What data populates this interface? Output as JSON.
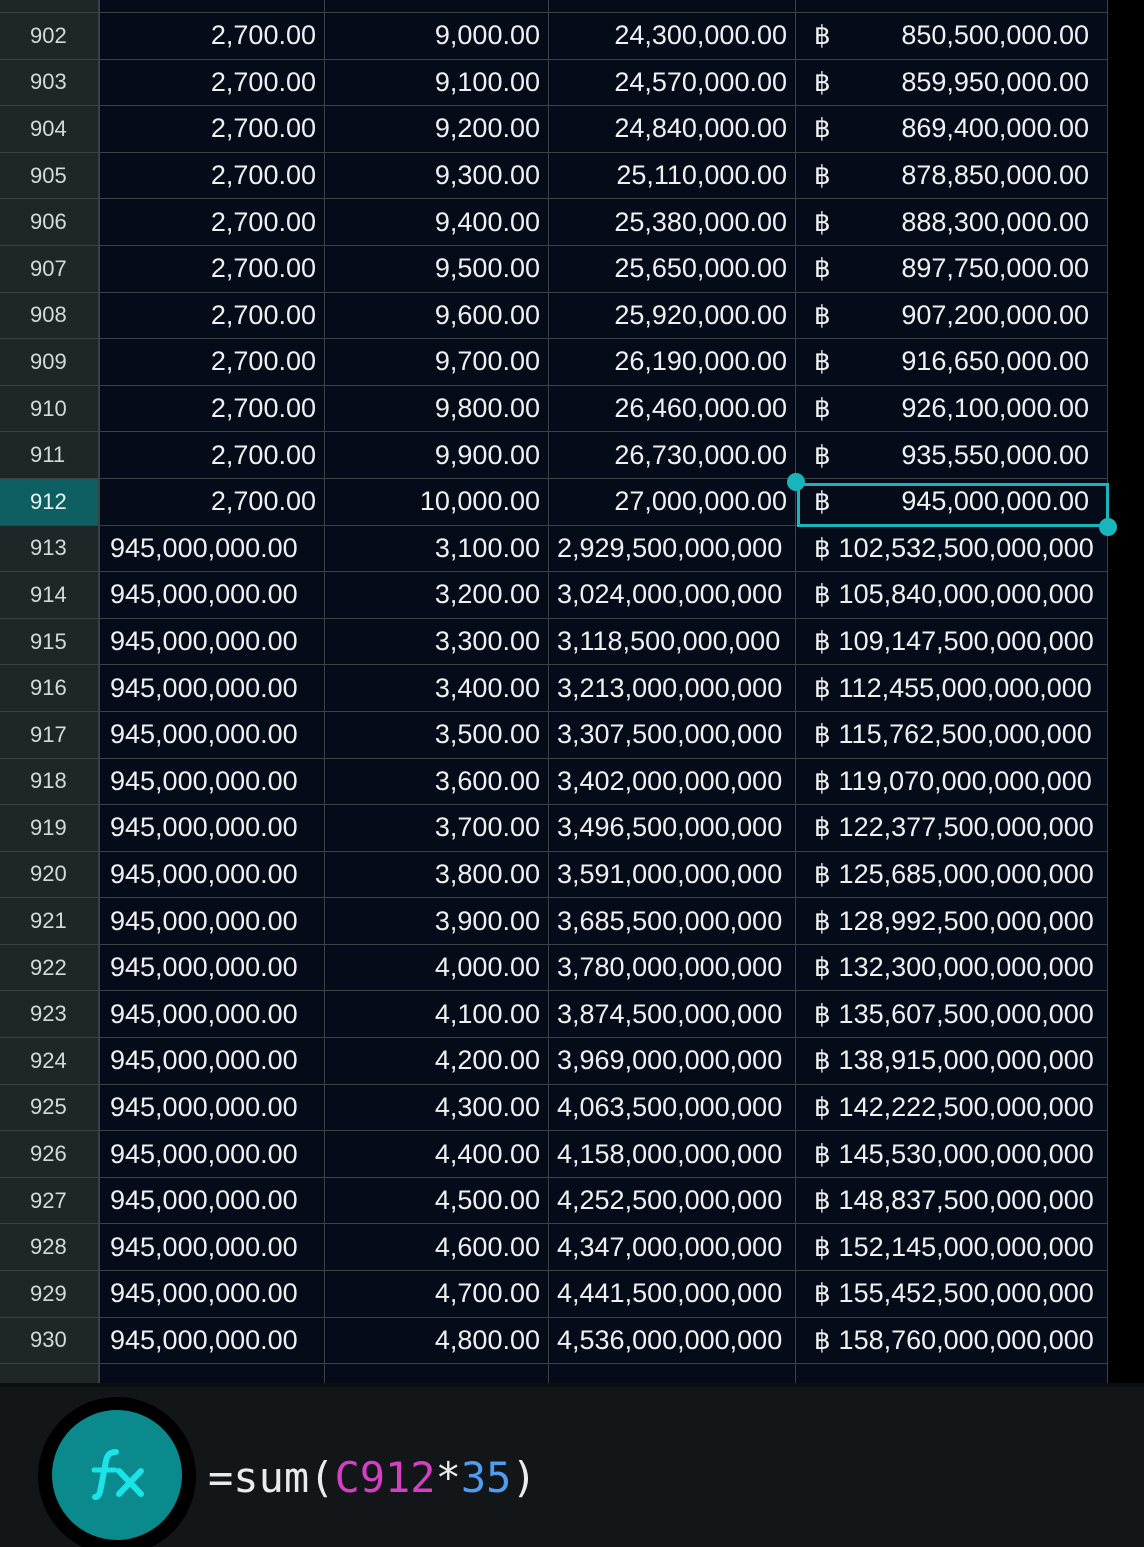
{
  "currency_symbol": "฿",
  "colors": {
    "selection": "#18b6bb",
    "cell_background": "#050b18",
    "row_header_background": "#1f2628",
    "active_row_header": "#0e5f62",
    "fx_button": "#0b8a8e",
    "formula_ref": "#d63fc4",
    "formula_number": "#4f9cf0"
  },
  "selected_cell_row": "912",
  "rows": [
    {
      "num": "902",
      "a": "2,700.00",
      "b": "9,000.00",
      "c": "24,300,000.00",
      "d": "850,500,000.00"
    },
    {
      "num": "903",
      "a": "2,700.00",
      "b": "9,100.00",
      "c": "24,570,000.00",
      "d": "859,950,000.00"
    },
    {
      "num": "904",
      "a": "2,700.00",
      "b": "9,200.00",
      "c": "24,840,000.00",
      "d": "869,400,000.00"
    },
    {
      "num": "905",
      "a": "2,700.00",
      "b": "9,300.00",
      "c": "25,110,000.00",
      "d": "878,850,000.00"
    },
    {
      "num": "906",
      "a": "2,700.00",
      "b": "9,400.00",
      "c": "25,380,000.00",
      "d": "888,300,000.00"
    },
    {
      "num": "907",
      "a": "2,700.00",
      "b": "9,500.00",
      "c": "25,650,000.00",
      "d": "897,750,000.00"
    },
    {
      "num": "908",
      "a": "2,700.00",
      "b": "9,600.00",
      "c": "25,920,000.00",
      "d": "907,200,000.00"
    },
    {
      "num": "909",
      "a": "2,700.00",
      "b": "9,700.00",
      "c": "26,190,000.00",
      "d": "916,650,000.00"
    },
    {
      "num": "910",
      "a": "2,700.00",
      "b": "9,800.00",
      "c": "26,460,000.00",
      "d": "926,100,000.00"
    },
    {
      "num": "911",
      "a": "2,700.00",
      "b": "9,900.00",
      "c": "26,730,000.00",
      "d": "935,550,000.00"
    },
    {
      "num": "912",
      "a": "2,700.00",
      "b": "10,000.00",
      "c": "27,000,000.00",
      "d": "945,000,000.00"
    },
    {
      "num": "913",
      "a": "945,000,000.00",
      "b": "3,100.00",
      "c": "2,929,500,000,000",
      "d": "102,532,500,000,000"
    },
    {
      "num": "914",
      "a": "945,000,000.00",
      "b": "3,200.00",
      "c": "3,024,000,000,000",
      "d": "105,840,000,000,000"
    },
    {
      "num": "915",
      "a": "945,000,000.00",
      "b": "3,300.00",
      "c": "3,118,500,000,000",
      "d": "109,147,500,000,000"
    },
    {
      "num": "916",
      "a": "945,000,000.00",
      "b": "3,400.00",
      "c": "3,213,000,000,000",
      "d": "112,455,000,000,000"
    },
    {
      "num": "917",
      "a": "945,000,000.00",
      "b": "3,500.00",
      "c": "3,307,500,000,000",
      "d": "115,762,500,000,000"
    },
    {
      "num": "918",
      "a": "945,000,000.00",
      "b": "3,600.00",
      "c": "3,402,000,000,000",
      "d": "119,070,000,000,000"
    },
    {
      "num": "919",
      "a": "945,000,000.00",
      "b": "3,700.00",
      "c": "3,496,500,000,000",
      "d": "122,377,500,000,000"
    },
    {
      "num": "920",
      "a": "945,000,000.00",
      "b": "3,800.00",
      "c": "3,591,000,000,000",
      "d": "125,685,000,000,000"
    },
    {
      "num": "921",
      "a": "945,000,000.00",
      "b": "3,900.00",
      "c": "3,685,500,000,000",
      "d": "128,992,500,000,000"
    },
    {
      "num": "922",
      "a": "945,000,000.00",
      "b": "4,000.00",
      "c": "3,780,000,000,000",
      "d": "132,300,000,000,000"
    },
    {
      "num": "923",
      "a": "945,000,000.00",
      "b": "4,100.00",
      "c": "3,874,500,000,000",
      "d": "135,607,500,000,000"
    },
    {
      "num": "924",
      "a": "945,000,000.00",
      "b": "4,200.00",
      "c": "3,969,000,000,000",
      "d": "138,915,000,000,000"
    },
    {
      "num": "925",
      "a": "945,000,000.00",
      "b": "4,300.00",
      "c": "4,063,500,000,000",
      "d": "142,222,500,000,000"
    },
    {
      "num": "926",
      "a": "945,000,000.00",
      "b": "4,400.00",
      "c": "4,158,000,000,000",
      "d": "145,530,000,000,000"
    },
    {
      "num": "927",
      "a": "945,000,000.00",
      "b": "4,500.00",
      "c": "4,252,500,000,000",
      "d": "148,837,500,000,000"
    },
    {
      "num": "928",
      "a": "945,000,000.00",
      "b": "4,600.00",
      "c": "4,347,000,000,000",
      "d": "152,145,000,000,000"
    },
    {
      "num": "929",
      "a": "945,000,000.00",
      "b": "4,700.00",
      "c": "4,441,500,000,000",
      "d": "155,452,500,000,000"
    },
    {
      "num": "930",
      "a": "945,000,000.00",
      "b": "4,800.00",
      "c": "4,536,000,000,000",
      "d": "158,760,000,000,000"
    }
  ],
  "formula_bar": {
    "icon": "fx-icon",
    "prefix": "=sum(",
    "cell_ref": "C912",
    "operator": "*",
    "number": "35",
    "suffix": ")"
  }
}
